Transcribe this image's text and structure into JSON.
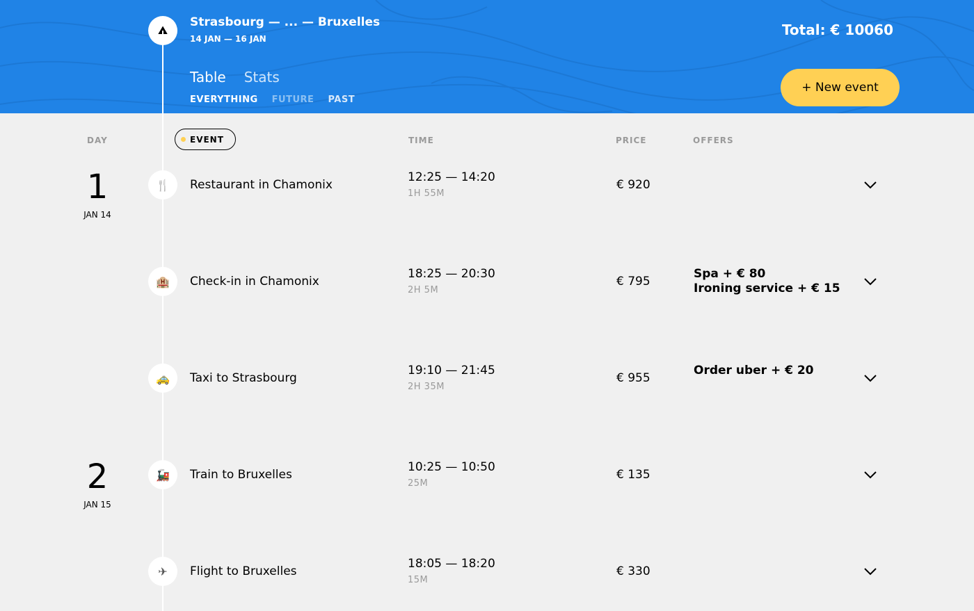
{
  "header": {
    "trip_title": "Strasbourg — ... — Bruxelles",
    "trip_dates": "14 JAN — 16 JAN",
    "total": "Total: € 10060",
    "new_event_label": "+ New event",
    "tabs": [
      "Table",
      "Stats"
    ],
    "filters": [
      "EVERYTHING",
      "FUTURE",
      "PAST"
    ],
    "logo_icon": "mountain-icon"
  },
  "columns": {
    "day": "DAY",
    "event": "EVENT",
    "time": "TIME",
    "price": "PRICE",
    "offers": "OFFERS"
  },
  "days": [
    {
      "number": "1",
      "date": "JAN 14"
    },
    {
      "number": "2",
      "date": "JAN 15"
    }
  ],
  "events": [
    {
      "icon": "restaurant-icon",
      "glyph": "🍴",
      "title": "Restaurant in Chamonix",
      "time": "12:25 — 14:20",
      "duration": "1H 55M",
      "price": "€ 920",
      "offers": []
    },
    {
      "icon": "hotel-icon",
      "glyph": "🏨",
      "title": "Check-in in Chamonix",
      "time": "18:25 — 20:30",
      "duration": "2H 5M",
      "price": "€ 795",
      "offers": [
        "Spa + € 80",
        "Ironing service + € 15"
      ]
    },
    {
      "icon": "taxi-icon",
      "glyph": "🚕",
      "title": "Taxi to Strasbourg",
      "time": "19:10 — 21:45",
      "duration": "2H 35M",
      "price": "€ 955",
      "offers": [
        "Order uber + € 20"
      ]
    },
    {
      "icon": "train-icon",
      "glyph": "🚂",
      "title": "Train to Bruxelles",
      "time": "10:25 — 10:50",
      "duration": "25M",
      "price": "€ 135",
      "offers": []
    },
    {
      "icon": "flight-icon",
      "glyph": "✈",
      "title": "Flight to Bruxelles",
      "time": "18:05 — 18:20",
      "duration": "15M",
      "price": "€ 330",
      "offers": []
    }
  ],
  "colors": {
    "header_bg": "#2083e6",
    "accent": "#ffd054",
    "page_bg": "#f0f0f0"
  }
}
